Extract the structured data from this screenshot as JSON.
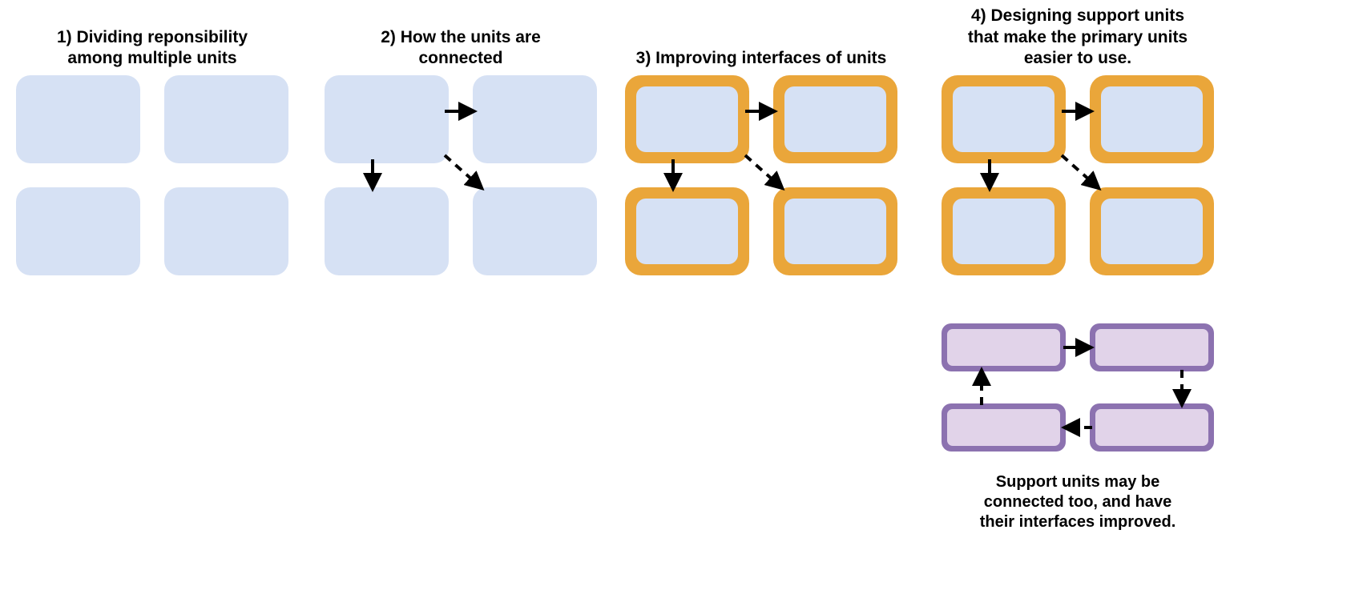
{
  "panels": {
    "p1": {
      "title": "1) Dividing reponsibility\namong multiple units"
    },
    "p2": {
      "title": "2) How the units are\nconnected"
    },
    "p3": {
      "title": "3) Improving interfaces of units"
    },
    "p4": {
      "title": "4) Designing support units\nthat make the primary units\neasier to use."
    }
  },
  "support_caption": "Support units may be\nconnected too, and have\ntheir interfaces improved.",
  "colors": {
    "box_fill": "#d6e1f4",
    "gold": "#eaa63a",
    "purple_border": "#8c72b0",
    "purple_fill": "#e1d3e9"
  }
}
